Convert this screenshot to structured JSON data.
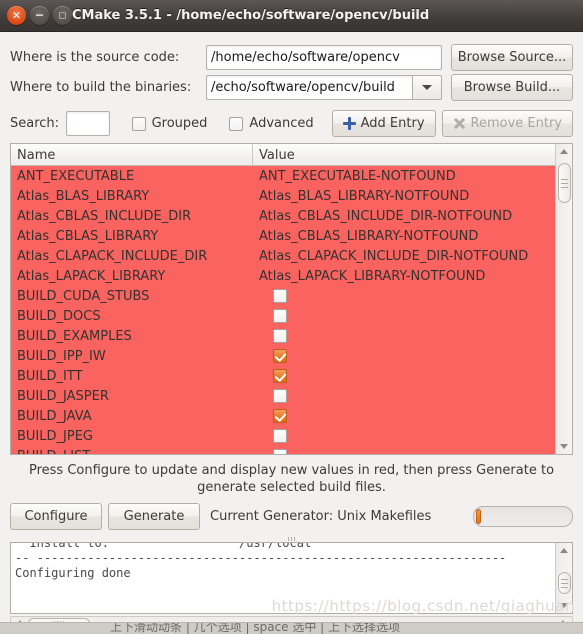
{
  "window": {
    "title": "CMake 3.5.1 - /home/echo/software/opencv/build",
    "buttons": {
      "close": "×",
      "minimize": "−",
      "maximize": "□"
    }
  },
  "form": {
    "source_label": "Where is the source code:",
    "source_value": "/home/echo/software/opencv",
    "browse_source_label": "Browse Source...",
    "build_label": "Where to build the binaries:",
    "build_value": "/echo/software/opencv/build",
    "browse_build_label": "Browse Build..."
  },
  "toolbar": {
    "search_label": "Search:",
    "search_value": "",
    "grouped_label": "Grouped",
    "grouped_checked": false,
    "advanced_label": "Advanced",
    "advanced_checked": false,
    "add_entry_label": "Add Entry",
    "remove_entry_label": "Remove Entry",
    "remove_entry_enabled": false
  },
  "table": {
    "headers": {
      "name": "Name",
      "value": "Value"
    },
    "highlight_color": "#fa6360",
    "rows": [
      {
        "name": "ANT_EXECUTABLE",
        "value": "ANT_EXECUTABLE-NOTFOUND",
        "type": "text"
      },
      {
        "name": "Atlas_BLAS_LIBRARY",
        "value": "Atlas_BLAS_LIBRARY-NOTFOUND",
        "type": "text"
      },
      {
        "name": "Atlas_CBLAS_INCLUDE_DIR",
        "value": "Atlas_CBLAS_INCLUDE_DIR-NOTFOUND",
        "type": "text"
      },
      {
        "name": "Atlas_CBLAS_LIBRARY",
        "value": "Atlas_CBLAS_LIBRARY-NOTFOUND",
        "type": "text"
      },
      {
        "name": "Atlas_CLAPACK_INCLUDE_DIR",
        "value": "Atlas_CLAPACK_INCLUDE_DIR-NOTFOUND",
        "type": "text"
      },
      {
        "name": "Atlas_LAPACK_LIBRARY",
        "value": "Atlas_LAPACK_LIBRARY-NOTFOUND",
        "type": "text"
      },
      {
        "name": "BUILD_CUDA_STUBS",
        "value": "",
        "type": "checkbox",
        "checked": false
      },
      {
        "name": "BUILD_DOCS",
        "value": "",
        "type": "checkbox",
        "checked": false
      },
      {
        "name": "BUILD_EXAMPLES",
        "value": "",
        "type": "checkbox",
        "checked": false
      },
      {
        "name": "BUILD_IPP_IW",
        "value": "",
        "type": "checkbox",
        "checked": true
      },
      {
        "name": "BUILD_ITT",
        "value": "",
        "type": "checkbox",
        "checked": true
      },
      {
        "name": "BUILD_JASPER",
        "value": "",
        "type": "checkbox",
        "checked": false
      },
      {
        "name": "BUILD_JAVA",
        "value": "",
        "type": "checkbox",
        "checked": true
      },
      {
        "name": "BUILD_JPEG",
        "value": "",
        "type": "checkbox",
        "checked": false
      },
      {
        "name": "BUILD_LIST",
        "value": "",
        "type": "checkbox",
        "checked": false
      }
    ]
  },
  "hint": "Press Configure to update and display new values in red, then press Generate to generate selected build files.",
  "actions": {
    "configure_label": "Configure",
    "generate_label": "Generate",
    "generator_text": "Current Generator: Unix Makefiles",
    "progress_percent": 5
  },
  "log": {
    "lines": [
      "  Install to:                  /usr/local",
      "",
      "-- -----------------------------------------------------------------",
      "",
      "Configuring done"
    ]
  },
  "watermark": "https://https://blog.csdn.net/qiaghuan",
  "bottom_strip": "上下滑动动条 | 几个选项 | space 选中 | 上下选择选项"
}
